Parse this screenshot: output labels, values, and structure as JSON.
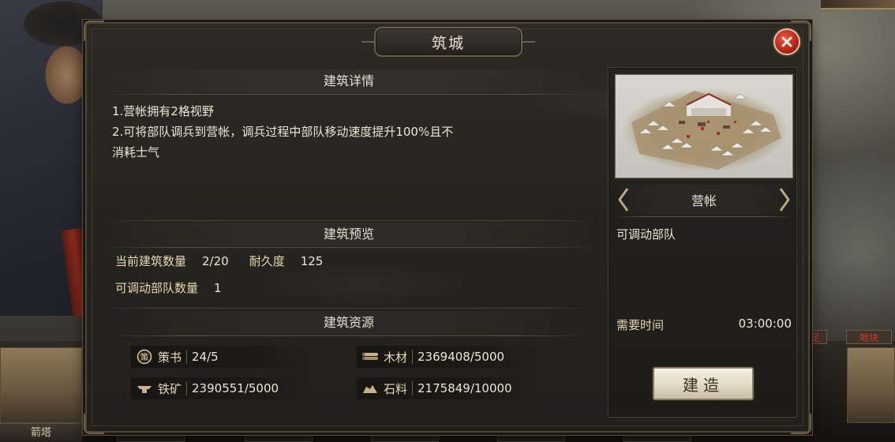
{
  "dialog": {
    "title": "筑城",
    "close_icon": "close-icon"
  },
  "details": {
    "heading": "建筑详情",
    "lines": [
      "1.营帐拥有2格视野",
      "2.可将部队调兵到营帐，调兵过程中部队移动速度提升100%且不",
      "消耗士气"
    ]
  },
  "preview_section": {
    "heading": "建筑预览",
    "current_count_label": "当前建筑数量",
    "current_count_value": "2/20",
    "durability_label": "耐久度",
    "durability_value": "125",
    "movable_troops_label": "可调动部队数量",
    "movable_troops_value": "1"
  },
  "resources": {
    "heading": "建筑资源",
    "items": [
      {
        "icon": "strategy-book-icon",
        "name": "策书",
        "value": "24/5"
      },
      {
        "icon": "wood-icon",
        "name": "木材",
        "value": "2369408/5000"
      },
      {
        "icon": "iron-ore-icon",
        "name": "铁矿",
        "value": "2390551/5000"
      },
      {
        "icon": "stone-icon",
        "name": "石料",
        "value": "2175849/10000"
      }
    ]
  },
  "building_panel": {
    "name": "营帐",
    "description": "可调动部队",
    "time_label": "需要时间",
    "time_value": "03:00:00",
    "build_label": "建造",
    "prev_icon": "chevron-left-icon",
    "next_icon": "chevron-right-icon"
  },
  "background": {
    "bottom_left_label": "箭塔",
    "side_tags": [
      "足",
      "地块"
    ]
  },
  "colors": {
    "panel_bg": "#26241f",
    "frame": "#4e4537",
    "label_gold": "#e8d8b4",
    "close_red": "#b8281c",
    "button_cream": "#e4dcc8"
  }
}
